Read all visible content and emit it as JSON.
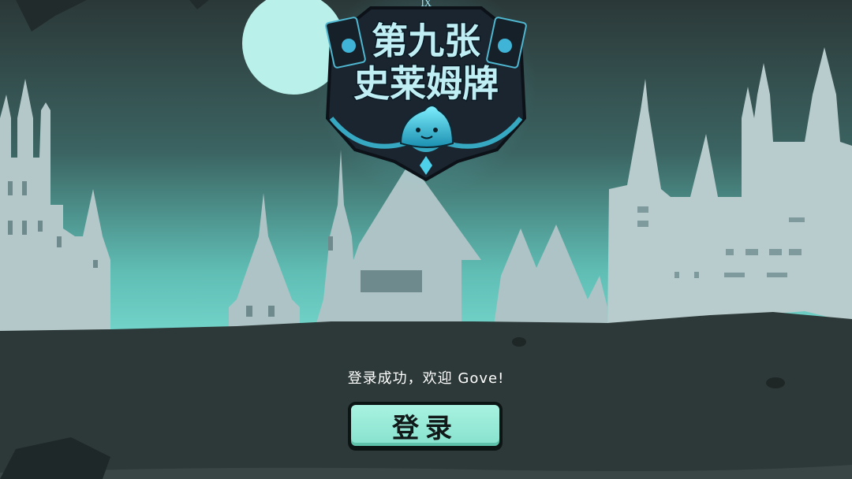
{
  "game": {
    "logo_line1": "第九张",
    "logo_line2": "史莱姆牌",
    "logo_badge": "IX"
  },
  "status_message": "登录成功，欢迎 Gove!",
  "login_button": {
    "label": "登录"
  },
  "colors": {
    "sky_top": "#2c3a3a",
    "sky_bottom": "#6fd0c6",
    "moon": "#b9f1ea",
    "castle": "#b9cccd",
    "ground": "#2e3938",
    "button_fill": "#9aedd9"
  }
}
